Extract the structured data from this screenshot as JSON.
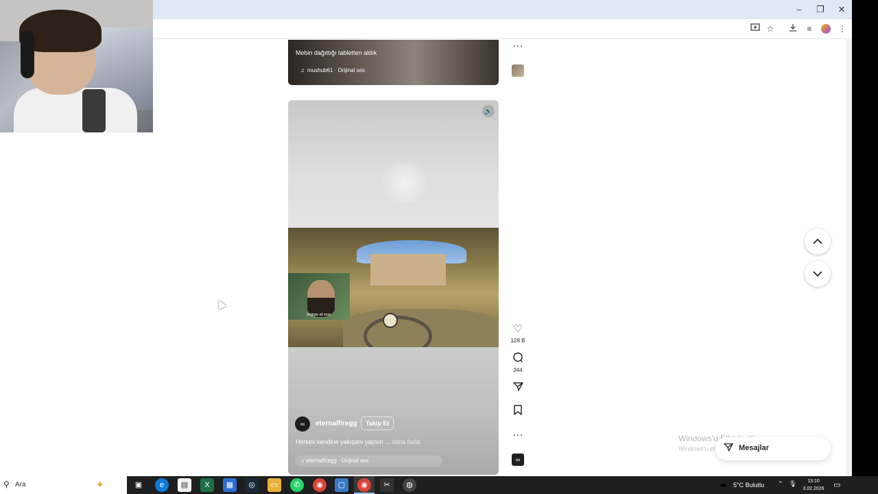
{
  "browser": {
    "window_controls": {
      "minimize": "–",
      "restore": "❐",
      "close": "✕"
    },
    "toolbar_icons": [
      "install-app-icon",
      "star-icon",
      "download-icon",
      "media-icon",
      "profile-icon",
      "menu-icon"
    ]
  },
  "feed": {
    "post1": {
      "caption": "Mebin dağıttığı tabletten aldık",
      "audio": "mushub61 · Orijinal ses"
    },
    "post2": {
      "facecam_label": "Değiştir all moin",
      "username": "eternalfiregg",
      "follow_label": "Takip Et",
      "caption": "Herkes kendine yakışanı yapsın ...",
      "more_label": "daha fazla",
      "audio": "eternalfiregg · Orijinal ses"
    },
    "actions": {
      "post1_more": "···",
      "like_count": "128 B",
      "comment_count": "344",
      "post2_more": "···"
    }
  },
  "nav": {
    "up": "︿",
    "down": "﹀"
  },
  "watermark": {
    "title": "Windows'u Etkinleştir",
    "subtitle": "Windows'u etkinleştirmek için Ayarlar'a gidin."
  },
  "messages": {
    "label": "Mesajlar"
  },
  "taskbar": {
    "search_placeholder": "Ara",
    "weather": "5°C  Bulutlu",
    "time": "13:10",
    "date": "3.02.2026",
    "colors": {
      "excel": "#1d7044",
      "chrome": "#db4437",
      "edge": "#0f7bd6",
      "whatsapp": "#25d366",
      "steam": "#1b2838",
      "files": "#e8b23a"
    }
  }
}
